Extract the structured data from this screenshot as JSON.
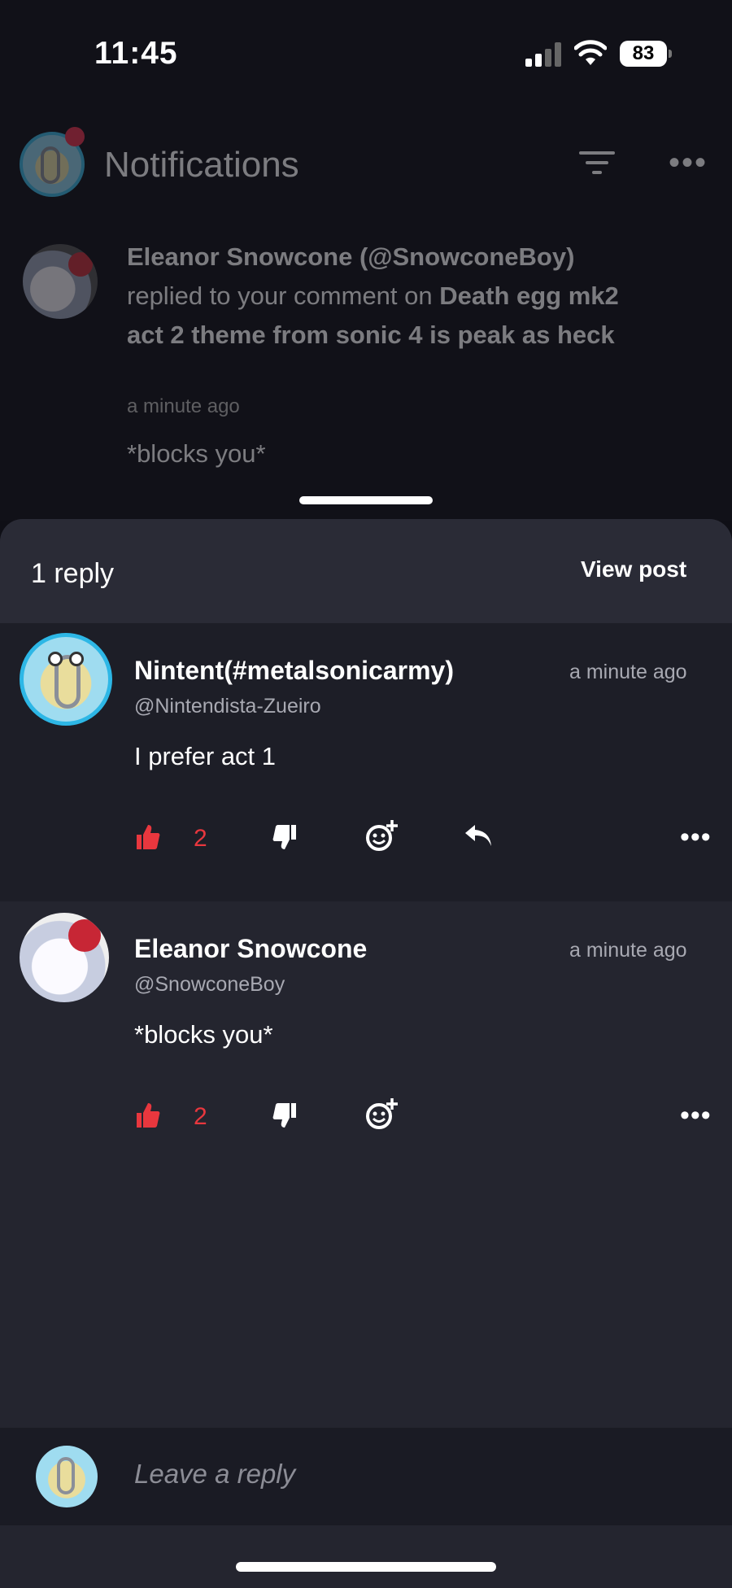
{
  "status_bar": {
    "time": "11:45",
    "battery": "83"
  },
  "background": {
    "header": {
      "title": "Notifications"
    },
    "notification": {
      "actor": "Eleanor Snowcone (@SnowconeBoy)",
      "action_text": "replied to your comment on",
      "post_title": "Death egg mk2 act 2 theme from sonic 4 is peak as heck",
      "time": "a minute ago",
      "reply": "*blocks you*"
    }
  },
  "sheet": {
    "reply_count": "1 reply",
    "view_post": "View post",
    "comments": [
      {
        "name": "Nintent(#metalsonicarmy)",
        "handle": "@Nintendista-Zueiro",
        "time": "a minute ago",
        "body": "I prefer act 1",
        "likes": "2"
      },
      {
        "name": "Eleanor Snowcone",
        "handle": "@SnowconeBoy",
        "time": "a minute ago",
        "body": "*blocks you*",
        "likes": "2"
      }
    ],
    "reply_placeholder": "Leave a reply"
  },
  "colors": {
    "accent_like": "#e8373e",
    "sheet_bg": "#24252f",
    "highlight_bg": "#1d1e27"
  },
  "icons": [
    "thumbs-up-icon",
    "thumbs-down-icon",
    "add-reaction-icon",
    "reply-icon",
    "more-icon",
    "filter-icon"
  ]
}
